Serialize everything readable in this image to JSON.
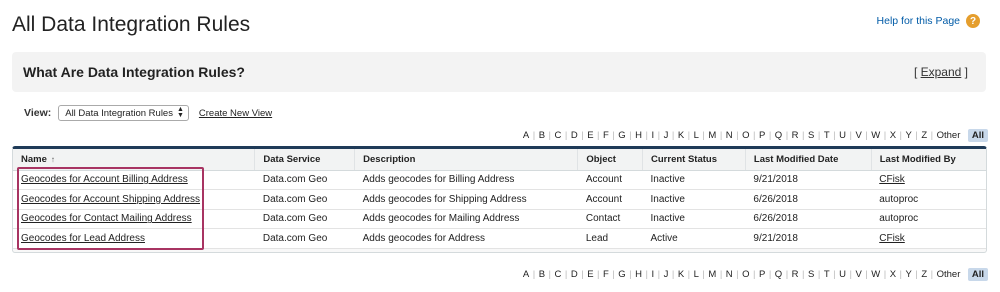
{
  "page": {
    "title": "All Data Integration Rules",
    "help_label": "Help for this Page",
    "help_icon": "question-icon"
  },
  "info": {
    "title": "What Are Data Integration Rules?",
    "expand_open": "[ ",
    "expand_label": "Expand",
    "expand_close": " ]"
  },
  "view": {
    "label": "View:",
    "selected": "All Data Integration Rules",
    "create_link": "Create New View"
  },
  "alphabet": [
    "A",
    "B",
    "C",
    "D",
    "E",
    "F",
    "G",
    "H",
    "I",
    "J",
    "K",
    "L",
    "M",
    "N",
    "O",
    "P",
    "Q",
    "R",
    "S",
    "T",
    "U",
    "V",
    "W",
    "X",
    "Y",
    "Z",
    "Other",
    "All"
  ],
  "table": {
    "columns": [
      "Name",
      "Data Service",
      "Description",
      "Object",
      "Current Status",
      "Last Modified Date",
      "Last Modified By"
    ],
    "sort_indicator": "↑",
    "rows": [
      [
        "Geocodes for Account Billing Address",
        "Data.com Geo",
        "Adds geocodes for Billing Address",
        "Account",
        "Inactive",
        "9/21/2018",
        "CFisk"
      ],
      [
        "Geocodes for Account Shipping Address",
        "Data.com Geo",
        "Adds geocodes for Shipping Address",
        "Account",
        "Inactive",
        "6/26/2018",
        "autoproc"
      ],
      [
        "Geocodes for Contact Mailing Address",
        "Data.com Geo",
        "Adds geocodes for Mailing Address",
        "Contact",
        "Inactive",
        "6/26/2018",
        "autoproc"
      ],
      [
        "Geocodes for Lead Address",
        "Data.com Geo",
        "Adds geocodes for Address",
        "Lead",
        "Active",
        "9/21/2018",
        "CFisk"
      ]
    ],
    "linked_modifiers": [
      "CFisk"
    ]
  },
  "colors": {
    "highlight": "#a83462",
    "header_bar": "#1f3b58",
    "help_icon": "#e59e2d",
    "all_badge": "#c8d8ea"
  }
}
